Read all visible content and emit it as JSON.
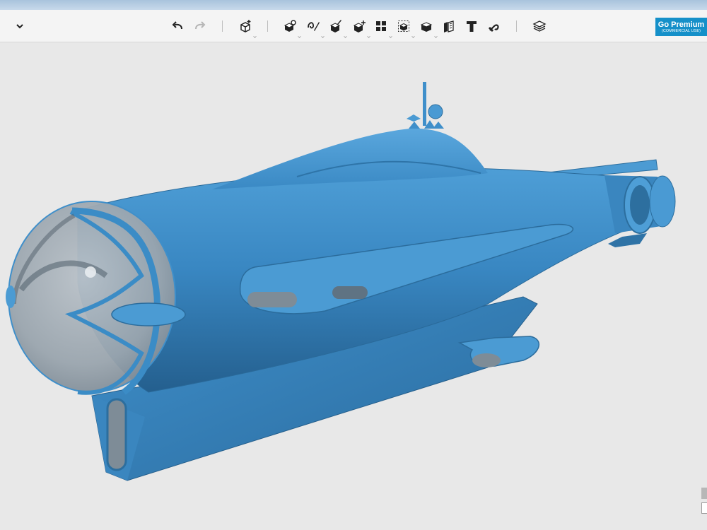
{
  "premium": {
    "title": "Go Premium",
    "subtitle": "(COMMERCIAL USE)",
    "color": "#1590c9"
  },
  "model": {
    "color": "#3b8cc6"
  },
  "toolbar": {
    "icons": [
      "chevron-down-icon",
      "undo-icon",
      "redo-icon",
      "add-primitive-icon",
      "transform-icon",
      "sketch-icon",
      "construct-icon",
      "modify-icon",
      "pattern-icon",
      "grouping-icon",
      "combine-icon",
      "measure-icon",
      "text-icon",
      "snap-icon",
      "material-icon"
    ]
  }
}
